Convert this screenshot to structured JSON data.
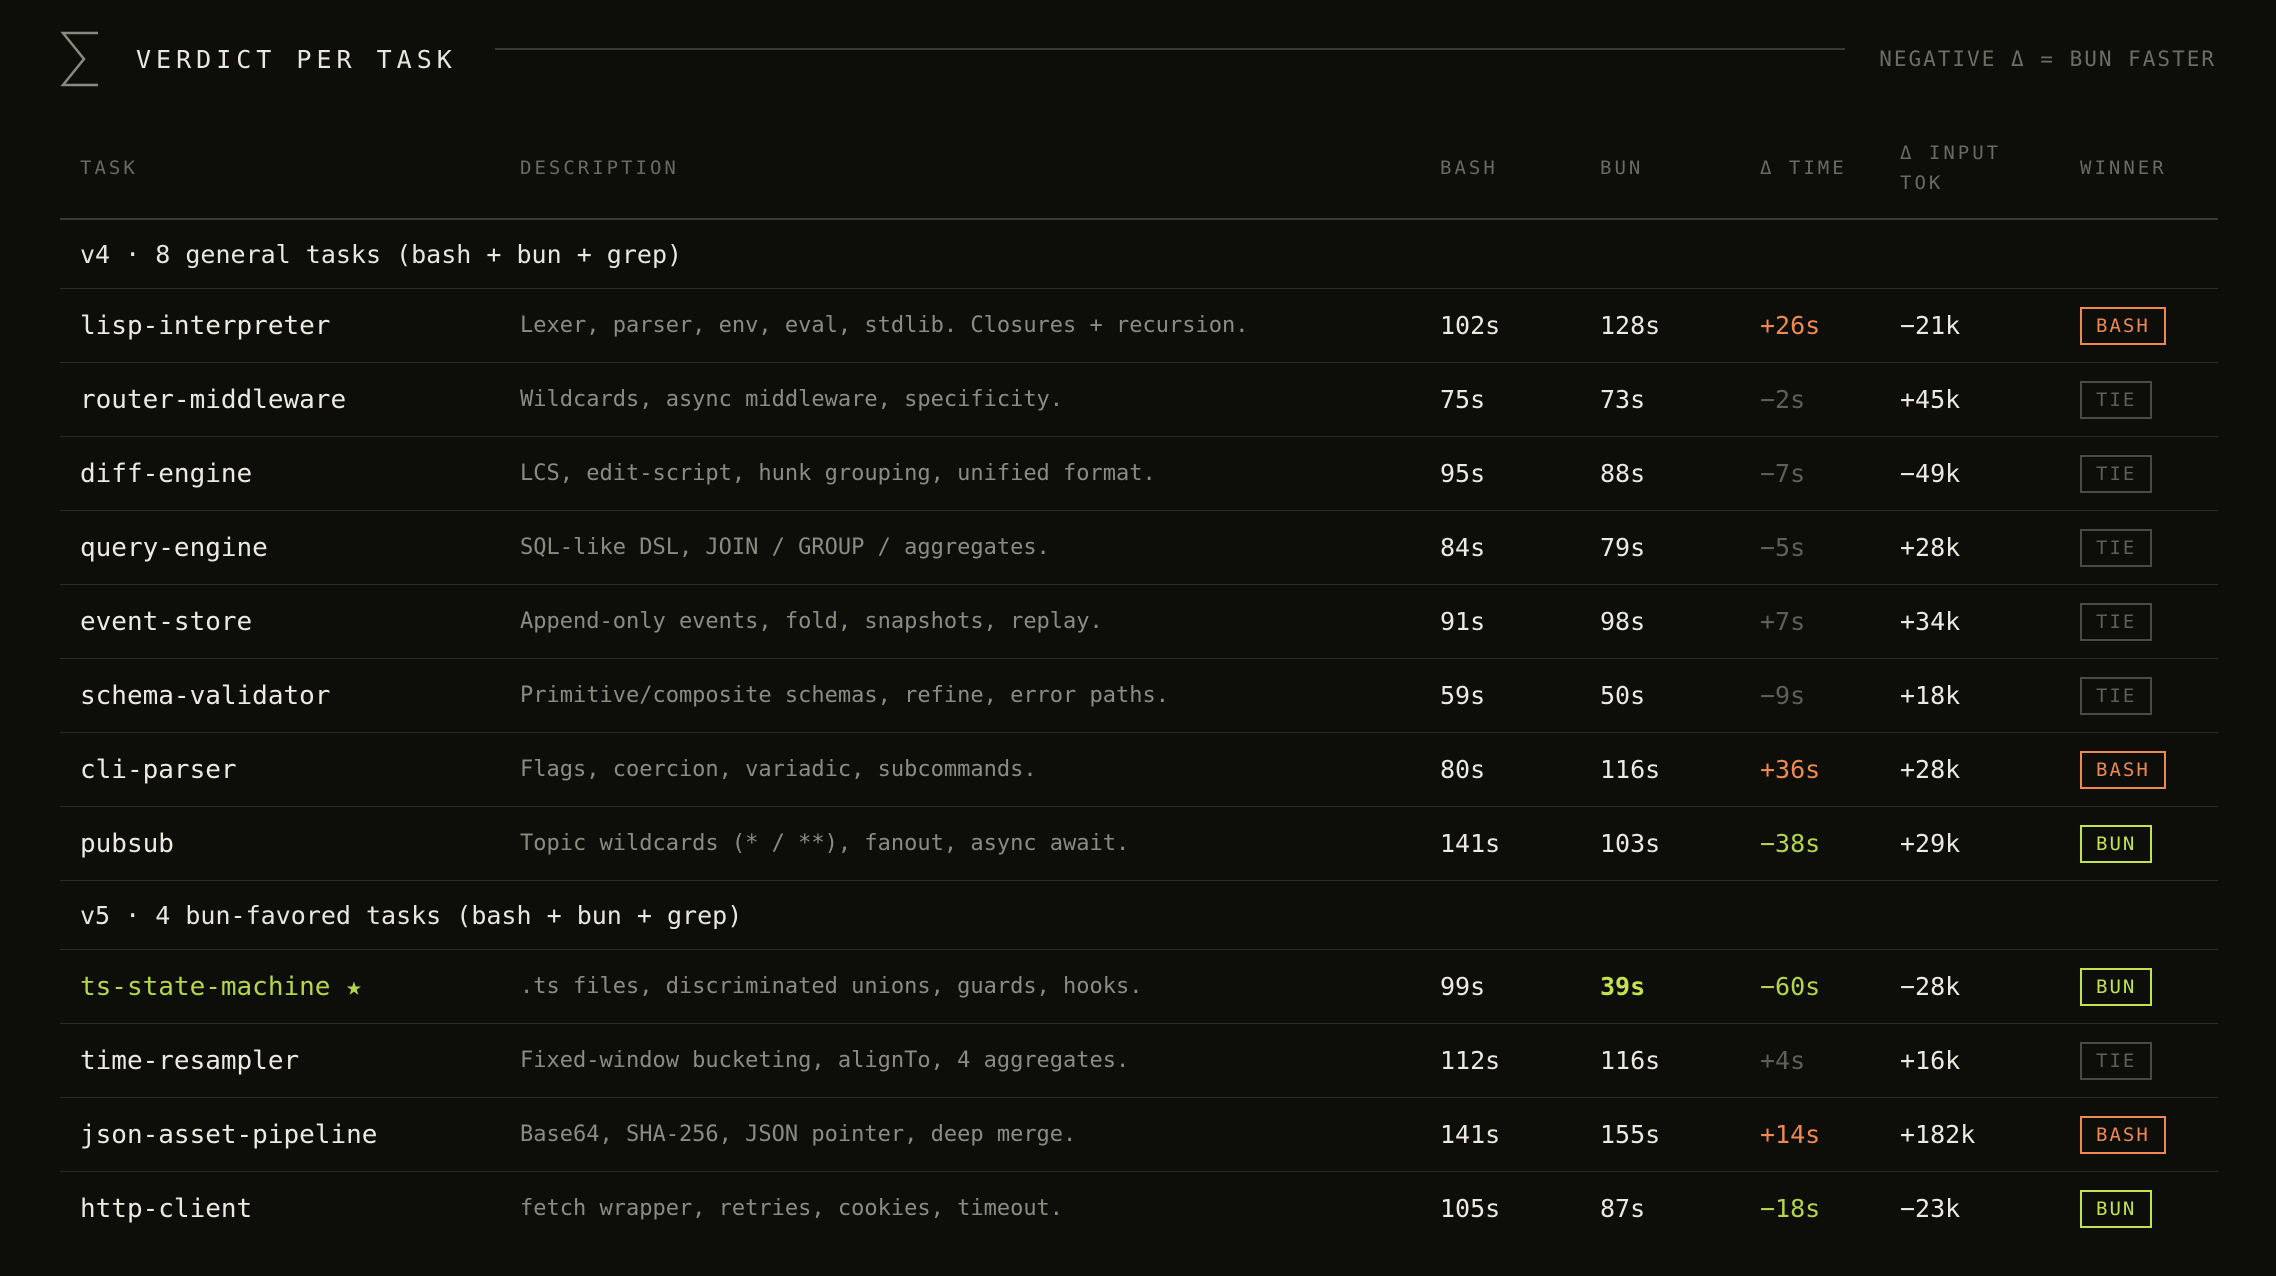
{
  "header": {
    "title": "VERDICT PER TASK",
    "note": "NEGATIVE Δ = BUN FASTER"
  },
  "columns": {
    "task": "TASK",
    "description": "DESCRIPTION",
    "bash": "BASH",
    "bun": "BUN",
    "delta_time": "Δ TIME",
    "delta_input": "Δ INPUT TOK",
    "winner": "WINNER"
  },
  "groups": [
    {
      "label": "v4 · 8 general tasks (bash + bun + grep)",
      "rows": [
        {
          "task": "lisp-interpreter",
          "description": "Lexer, parser, env, eval, stdlib. Closures + recursion.",
          "bash": "102s",
          "bun": "128s",
          "delta_time": "+26s",
          "delta_tone": "pos",
          "delta_input": "−21k",
          "winner": "BASH",
          "winner_tone": "bash"
        },
        {
          "task": "router-middleware",
          "description": "Wildcards, async middleware, specificity.",
          "bash": "75s",
          "bun": "73s",
          "delta_time": "−2s",
          "delta_tone": "muted",
          "delta_input": "+45k",
          "winner": "TIE",
          "winner_tone": "tie"
        },
        {
          "task": "diff-engine",
          "description": "LCS, edit-script, hunk grouping, unified format.",
          "bash": "95s",
          "bun": "88s",
          "delta_time": "−7s",
          "delta_tone": "muted",
          "delta_input": "−49k",
          "winner": "TIE",
          "winner_tone": "tie"
        },
        {
          "task": "query-engine",
          "description": "SQL-like DSL, JOIN / GROUP / aggregates.",
          "bash": "84s",
          "bun": "79s",
          "delta_time": "−5s",
          "delta_tone": "muted",
          "delta_input": "+28k",
          "winner": "TIE",
          "winner_tone": "tie"
        },
        {
          "task": "event-store",
          "description": "Append-only events, fold, snapshots, replay.",
          "bash": "91s",
          "bun": "98s",
          "delta_time": "+7s",
          "delta_tone": "muted",
          "delta_input": "+34k",
          "winner": "TIE",
          "winner_tone": "tie"
        },
        {
          "task": "schema-validator",
          "description": "Primitive/composite schemas, refine, error paths.",
          "bash": "59s",
          "bun": "50s",
          "delta_time": "−9s",
          "delta_tone": "muted",
          "delta_input": "+18k",
          "winner": "TIE",
          "winner_tone": "tie"
        },
        {
          "task": "cli-parser",
          "description": "Flags, coercion, variadic, subcommands.",
          "bash": "80s",
          "bun": "116s",
          "delta_time": "+36s",
          "delta_tone": "pos",
          "delta_input": "+28k",
          "winner": "BASH",
          "winner_tone": "bash"
        },
        {
          "task": "pubsub",
          "description": "Topic wildcards (* / **), fanout, async await.",
          "bash": "141s",
          "bun": "103s",
          "delta_time": "−38s",
          "delta_tone": "neg",
          "delta_input": "+29k",
          "winner": "BUN",
          "winner_tone": "bun"
        }
      ]
    },
    {
      "label": "v5 · 4 bun-favored tasks (bash + bun + grep)",
      "rows": [
        {
          "task": "ts-state-machine ★",
          "description": ".ts files, discriminated unions, guards, hooks.",
          "bash": "99s",
          "bun": "39s",
          "bun_highlight": true,
          "task_highlight": true,
          "delta_time": "−60s",
          "delta_tone": "neg",
          "delta_input": "−28k",
          "winner": "BUN",
          "winner_tone": "bun"
        },
        {
          "task": "time-resampler",
          "description": "Fixed-window bucketing, alignTo, 4 aggregates.",
          "bash": "112s",
          "bun": "116s",
          "delta_time": "+4s",
          "delta_tone": "muted",
          "delta_input": "+16k",
          "winner": "TIE",
          "winner_tone": "tie"
        },
        {
          "task": "json-asset-pipeline",
          "description": "Base64, SHA-256, JSON pointer, deep merge.",
          "bash": "141s",
          "bun": "155s",
          "delta_time": "+14s",
          "delta_tone": "pos",
          "delta_input": "+182k",
          "winner": "BASH",
          "winner_tone": "bash"
        },
        {
          "task": "http-client",
          "description": "fetch wrapper, retries, cookies, timeout.",
          "bash": "105s",
          "bun": "87s",
          "delta_time": "−18s",
          "delta_tone": "neg",
          "delta_input": "−23k",
          "winner": "BUN",
          "winner_tone": "bun"
        }
      ]
    }
  ],
  "colors": {
    "background": "#0d0d0a",
    "bash_accent": "#ee8a50",
    "bun_accent": "#c2e34f",
    "muted": "#5f5e57"
  },
  "icons": {
    "header": "sigma-icon"
  }
}
